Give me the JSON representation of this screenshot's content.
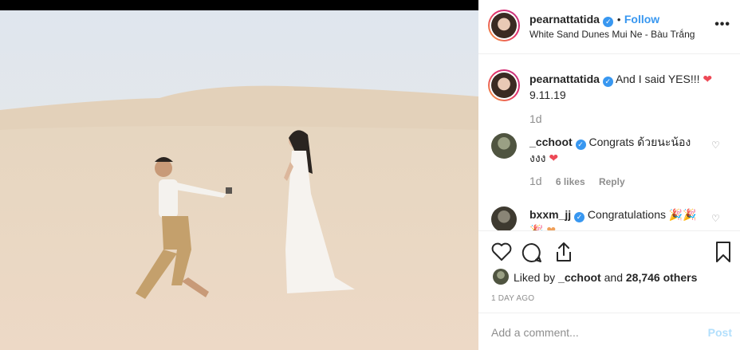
{
  "header": {
    "username": "pearnattatida",
    "follow_label": "Follow",
    "separator": "•",
    "location": "White Sand Dunes Mui Ne - Bàu Trắng",
    "more_icon": "more-dots-icon"
  },
  "caption": {
    "username": "pearnattatida",
    "text": "And I said YES!!!",
    "line2": "9.11.19",
    "time": "1d"
  },
  "comments": [
    {
      "username": "_cchoot",
      "text": "Congrats ด้วยนะน้อง",
      "text2": "งงง",
      "time": "1d",
      "likes": "6 likes",
      "reply": "Reply"
    },
    {
      "username": "bxxm_jj",
      "text": "Congratulations"
    }
  ],
  "actions": {
    "liked_by_prefix": "Liked by",
    "liked_by_user": "_cchoot",
    "liked_by_and": "and",
    "likes_count": "28,746 others",
    "date": "1 DAY AGO"
  },
  "comment_box": {
    "placeholder": "Add a comment...",
    "post_label": "Post"
  },
  "colors": {
    "accent": "#3897f0",
    "heart": "#ed4956",
    "muted": "#8e8e8e"
  }
}
